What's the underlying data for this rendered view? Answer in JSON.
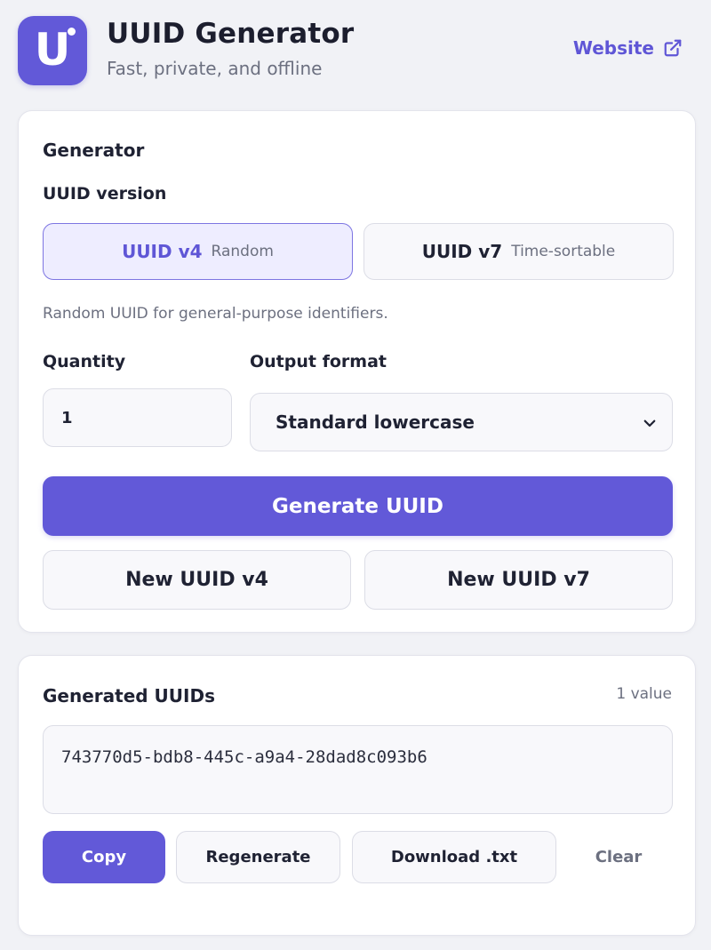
{
  "header": {
    "logo_letter": "U",
    "title": "UUID Generator",
    "subtitle": "Fast, private, and offline",
    "website_label": "Website"
  },
  "generator": {
    "section_title": "Generator",
    "version_label": "UUID version",
    "versions": [
      {
        "label": "UUID v4",
        "sublabel": "Random",
        "selected": true
      },
      {
        "label": "UUID v7",
        "sublabel": "Time-sortable",
        "selected": false
      }
    ],
    "help_text": "Random UUID for general-purpose identifiers.",
    "quantity_label": "Quantity",
    "quantity_value": "1",
    "format_label": "Output format",
    "format_value": "Standard lowercase",
    "generate_label": "Generate UUID",
    "new_v4_label": "New UUID v4",
    "new_v7_label": "New UUID v7"
  },
  "output": {
    "section_title": "Generated UUIDs",
    "count_label": "1 value",
    "uuids": [
      "743770d5-bdb8-445c-a9a4-28dad8c093b6"
    ],
    "copy_label": "Copy",
    "regenerate_label": "Regenerate",
    "download_label": "Download .txt",
    "clear_label": "Clear"
  },
  "colors": {
    "accent": "#6259d8",
    "background": "#f1f2f6",
    "card": "#ffffff",
    "selected_bg": "#eeedff"
  }
}
